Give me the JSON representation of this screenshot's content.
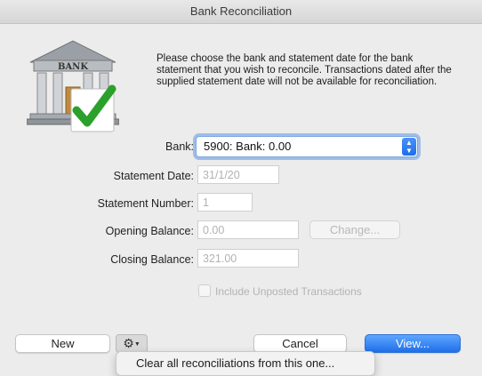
{
  "window": {
    "title": "Bank Reconciliation"
  },
  "message": "Please choose the bank and statement date for the bank statement that you wish to reconcile.  Transactions dated after the supplied statement date will not be available for reconciliation.",
  "bank_art": {
    "sign_text": "BANK"
  },
  "form": {
    "bank_label": "Bank:",
    "bank_value": "5900: Bank: 0.00",
    "statement_date_label": "Statement Date:",
    "statement_date_value": "31/1/20",
    "statement_number_label": "Statement Number:",
    "statement_number_value": "1",
    "opening_balance_label": "Opening Balance:",
    "opening_balance_value": "0.00",
    "change_button": "Change...",
    "closing_balance_label": "Closing Balance:",
    "closing_balance_value": "321.00",
    "include_unposted_label": "Include Unposted Transactions"
  },
  "buttons": {
    "new": "New",
    "cancel": "Cancel",
    "view": "View..."
  },
  "gear_menu": {
    "items": [
      "Clear all reconciliations from this one..."
    ]
  },
  "colors": {
    "accent": "#1f6fe8",
    "check_green": "#2aa12a"
  }
}
